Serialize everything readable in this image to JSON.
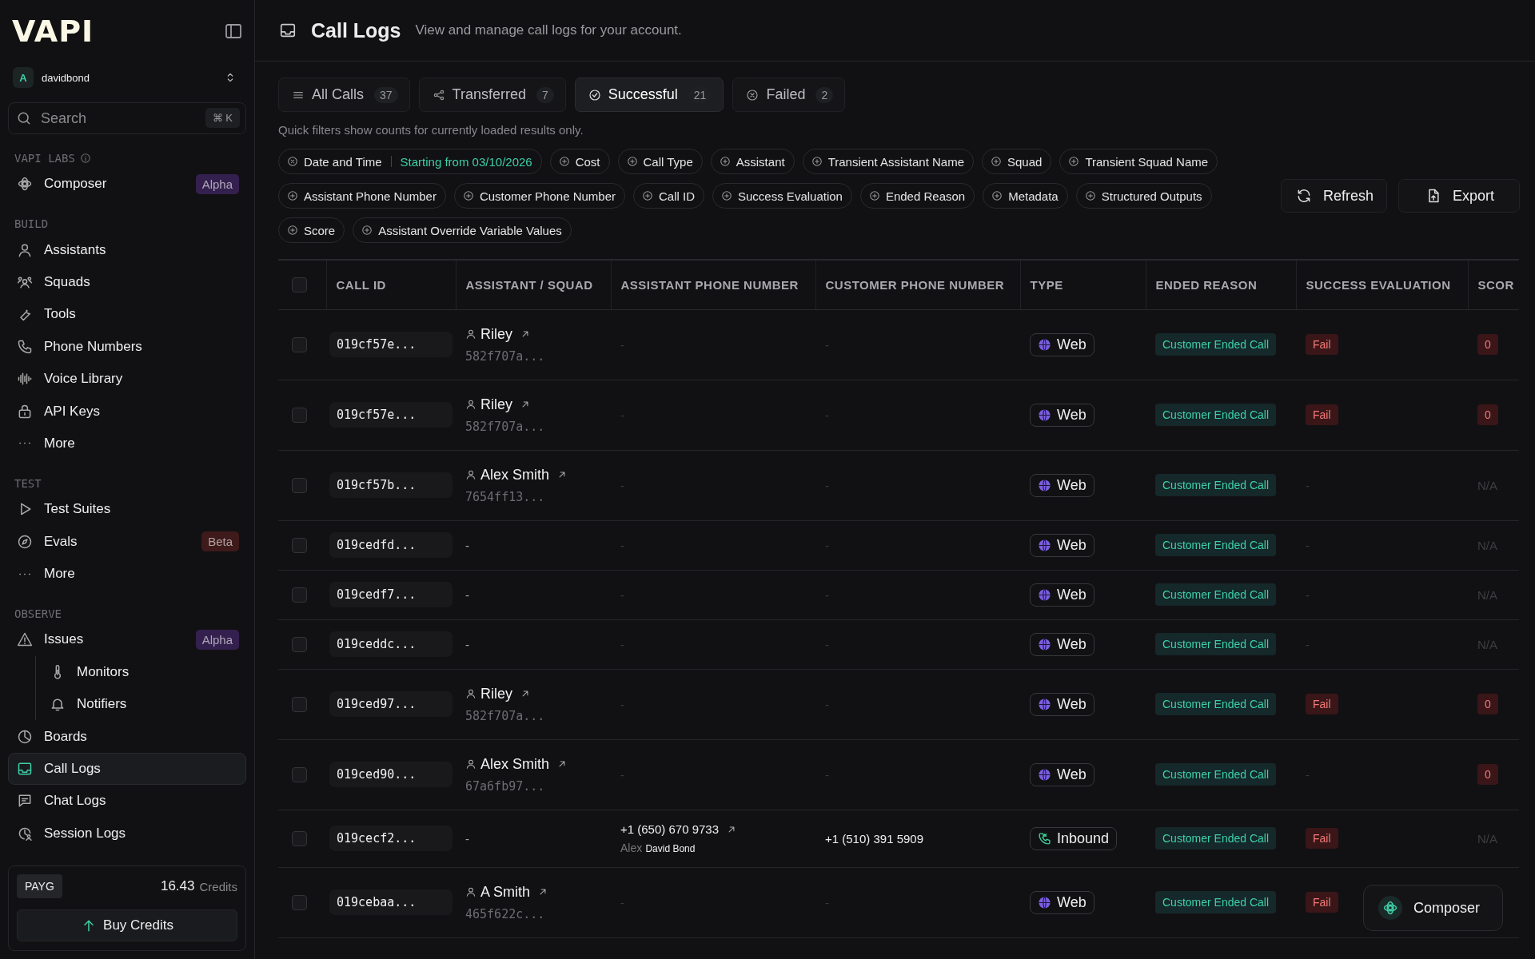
{
  "sidebar": {
    "logo": "VAPI",
    "org": {
      "avatar": "A",
      "name": "davidbond"
    },
    "search": {
      "placeholder": "Search",
      "shortcut": "⌘ K"
    },
    "sections": [
      {
        "title": "VAPI LABS",
        "items": [
          {
            "label": "Composer",
            "selected": false,
            "badge": {
              "text": "Alpha",
              "color": "#34204e"
            }
          }
        ]
      },
      {
        "title": "BUILD",
        "items": [
          {
            "label": "Assistants",
            "selected": false
          },
          {
            "label": "Squads",
            "selected": false
          },
          {
            "label": "Tools",
            "selected": false
          },
          {
            "label": "Phone Numbers",
            "selected": false
          },
          {
            "label": "Voice Library",
            "selected": false
          },
          {
            "label": "API Keys",
            "selected": false
          },
          {
            "label": "More",
            "selected": false
          }
        ]
      },
      {
        "title": "TEST",
        "items": [
          {
            "label": "Test Suites",
            "selected": false
          },
          {
            "label": "Evals",
            "selected": false,
            "badge": {
              "text": "Beta",
              "color": "#3e1a1a"
            }
          },
          {
            "label": "More",
            "selected": false
          }
        ]
      },
      {
        "title": "OBSERVE",
        "items": [
          {
            "label": "Issues",
            "selected": false,
            "badge": {
              "text": "Alpha",
              "color": "#34204e"
            },
            "children": [
              {
                "label": "Monitors",
                "selected": false
              },
              {
                "label": "Notifiers",
                "selected": false
              }
            ]
          },
          {
            "label": "Boards",
            "selected": false
          },
          {
            "label": "Call Logs",
            "selected": true
          },
          {
            "label": "Chat Logs",
            "selected": false
          },
          {
            "label": "Session Logs",
            "selected": false
          }
        ]
      }
    ],
    "footer": {
      "plan": "PAYG",
      "credits": "16.43",
      "credits_label": "Credits",
      "button": "Buy Credits"
    }
  },
  "header": {
    "title": "Call Logs",
    "subtitle": "View and manage call logs for your account."
  },
  "tabs": [
    {
      "label": "All Calls",
      "count": "37",
      "selected": false
    },
    {
      "label": "Transferred",
      "count": "7",
      "selected": false
    },
    {
      "label": "Successful",
      "count": "21",
      "selected": true
    },
    {
      "label": "Failed",
      "count": "2",
      "selected": false
    }
  ],
  "note": "Quick filters show counts for currently loaded results only.",
  "filters": [
    {
      "kind": "active",
      "label": "Date and Time",
      "value": "Starting from 03/10/2026"
    },
    {
      "kind": "add",
      "label": "Cost"
    },
    {
      "kind": "add",
      "label": "Call Type"
    },
    {
      "kind": "add",
      "label": "Assistant"
    },
    {
      "kind": "add",
      "label": "Transient Assistant Name"
    },
    {
      "kind": "add",
      "label": "Squad"
    },
    {
      "kind": "add",
      "label": "Transient Squad Name"
    },
    {
      "kind": "add",
      "label": "Assistant Phone Number"
    },
    {
      "kind": "add",
      "label": "Customer Phone Number"
    },
    {
      "kind": "add",
      "label": "Call ID"
    },
    {
      "kind": "add",
      "label": "Success Evaluation"
    },
    {
      "kind": "add",
      "label": "Ended Reason"
    },
    {
      "kind": "add",
      "label": "Metadata"
    },
    {
      "kind": "add",
      "label": "Structured Outputs"
    },
    {
      "kind": "add",
      "label": "Score"
    },
    {
      "kind": "add",
      "label": "Assistant Override Variable Values"
    }
  ],
  "actions": [
    "Refresh",
    "Export"
  ],
  "table": {
    "select_all": {
      "checked": false
    },
    "columns": [
      "CALL ID",
      "ASSISTANT / SQUAD",
      "ASSISTANT PHONE NUMBER",
      "CUSTOMER PHONE NUMBER",
      "TYPE",
      "ENDED REASON",
      "SUCCESS EVALUATION",
      "SCOR"
    ],
    "rows": [
      {
        "checked": false,
        "call_id": "019cf57e...",
        "assistant": {
          "kind": "link",
          "name": "Riley",
          "id": "582f707a..."
        },
        "assistant_phone": {
          "kind": "none",
          "text": "-"
        },
        "customer_phone": "-",
        "type": {
          "kind": "web",
          "label": "Web"
        },
        "ended_reason": "Customer Ended Call",
        "success": {
          "kind": "fail",
          "label": "Fail"
        },
        "score": {
          "kind": "fail",
          "label": "0"
        }
      },
      {
        "checked": false,
        "call_id": "019cf57e...",
        "assistant": {
          "kind": "link",
          "name": "Riley",
          "id": "582f707a..."
        },
        "assistant_phone": {
          "kind": "none",
          "text": "-"
        },
        "customer_phone": "-",
        "type": {
          "kind": "web",
          "label": "Web"
        },
        "ended_reason": "Customer Ended Call",
        "success": {
          "kind": "fail",
          "label": "Fail"
        },
        "score": {
          "kind": "fail",
          "label": "0"
        }
      },
      {
        "checked": false,
        "call_id": "019cf57b...",
        "assistant": {
          "kind": "link",
          "name": "Alex Smith",
          "id": "7654ff13..."
        },
        "assistant_phone": {
          "kind": "none",
          "text": "-"
        },
        "customer_phone": "-",
        "type": {
          "kind": "web",
          "label": "Web"
        },
        "ended_reason": "Customer Ended Call",
        "success": {
          "kind": "none",
          "label": "-"
        },
        "score": {
          "kind": "na",
          "label": "N/A"
        }
      },
      {
        "checked": false,
        "call_id": "019cedfd...",
        "assistant": {
          "kind": "none",
          "text": "-"
        },
        "assistant_phone": {
          "kind": "none",
          "text": "-"
        },
        "customer_phone": "-",
        "type": {
          "kind": "web",
          "label": "Web"
        },
        "ended_reason": "Customer Ended Call",
        "success": {
          "kind": "none",
          "label": "-"
        },
        "score": {
          "kind": "na",
          "label": "N/A"
        }
      },
      {
        "checked": false,
        "call_id": "019cedf7...",
        "assistant": {
          "kind": "none",
          "text": "-"
        },
        "assistant_phone": {
          "kind": "none",
          "text": "-"
        },
        "customer_phone": "-",
        "type": {
          "kind": "web",
          "label": "Web"
        },
        "ended_reason": "Customer Ended Call",
        "success": {
          "kind": "none",
          "label": "-"
        },
        "score": {
          "kind": "na",
          "label": "N/A"
        }
      },
      {
        "checked": false,
        "call_id": "019ceddc...",
        "assistant": {
          "kind": "none",
          "text": "-"
        },
        "assistant_phone": {
          "kind": "none",
          "text": "-"
        },
        "customer_phone": "-",
        "type": {
          "kind": "web",
          "label": "Web"
        },
        "ended_reason": "Customer Ended Call",
        "success": {
          "kind": "none",
          "label": "-"
        },
        "score": {
          "kind": "na",
          "label": "N/A"
        }
      },
      {
        "checked": false,
        "call_id": "019ced97...",
        "assistant": {
          "kind": "link",
          "name": "Riley",
          "id": "582f707a..."
        },
        "assistant_phone": {
          "kind": "none",
          "text": "-"
        },
        "customer_phone": "-",
        "type": {
          "kind": "web",
          "label": "Web"
        },
        "ended_reason": "Customer Ended Call",
        "success": {
          "kind": "fail",
          "label": "Fail"
        },
        "score": {
          "kind": "fail",
          "label": "0"
        }
      },
      {
        "checked": false,
        "call_id": "019ced90...",
        "assistant": {
          "kind": "link",
          "name": "Alex Smith",
          "id": "67a6fb97..."
        },
        "assistant_phone": {
          "kind": "none",
          "text": "-"
        },
        "customer_phone": "-",
        "type": {
          "kind": "web",
          "label": "Web"
        },
        "ended_reason": "Customer Ended Call",
        "success": {
          "kind": "none",
          "label": "-"
        },
        "score": {
          "kind": "fail",
          "label": "0"
        }
      },
      {
        "checked": false,
        "call_id": "019cecf2...",
        "assistant": {
          "kind": "none",
          "text": "-"
        },
        "assistant_phone": {
          "kind": "number",
          "number": "+1 (650) 670 9733",
          "label": "Alex",
          "owner": "David Bond"
        },
        "customer_phone": "+1 (510) 391 5909",
        "type": {
          "kind": "inbound",
          "label": "Inbound"
        },
        "ended_reason": "Customer Ended Call",
        "success": {
          "kind": "fail",
          "label": "Fail"
        },
        "score": {
          "kind": "na",
          "label": "N/A"
        }
      },
      {
        "checked": false,
        "call_id": "019cebaa...",
        "assistant": {
          "kind": "link",
          "name": "A Smith",
          "id": "465f622c..."
        },
        "assistant_phone": {
          "kind": "none",
          "text": "-"
        },
        "customer_phone": "-",
        "type": {
          "kind": "web",
          "label": "Web"
        },
        "ended_reason": "Customer Ended Call",
        "success": {
          "kind": "fail",
          "label": "Fail"
        }
      }
    ]
  },
  "floating_button": "Composer"
}
